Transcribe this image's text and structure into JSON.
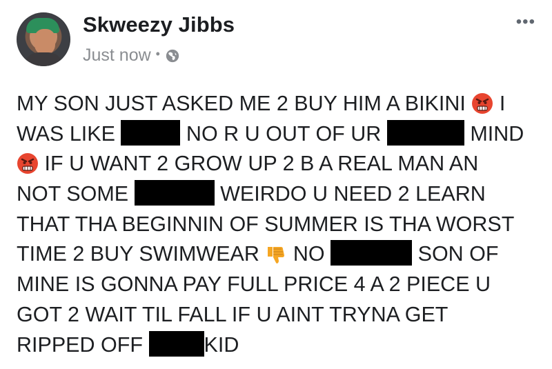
{
  "post": {
    "author": "Skweezy Jibbs",
    "timestamp": "Just now",
    "privacy_icon": "globe-icon",
    "more_label": "•••",
    "lines": [
      [
        "MY SON JUST ASKED ME 2 BUY HIM A BIKINI",
        "I"
      ],
      [
        "WAS LIKE",
        "NO R U OUT OF UR",
        "MIND"
      ],
      [
        "IF U WANT 2 GROW UP 2 B A REAL MAN AN"
      ],
      [
        "NOT SOME",
        "WEIRDO U NEED 2 LEARN"
      ],
      [
        "THAT THA BEGINNIN OF SUMMER IS THA WORST"
      ],
      [
        "TIME 2 BUY SWIMWEAR",
        "NO",
        "SON OF"
      ],
      [
        "MINE IS GONNA PAY FULL PRICE 4 A 2 PIECE U"
      ],
      [
        "GOT 2 WAIT TIL FALL IF U AINT TRYNA GET"
      ],
      [
        "RIPPED OFF",
        "KID"
      ]
    ],
    "emojis": [
      "angry-face-icon",
      "angry-face-icon",
      "thumbs-down-icon"
    ],
    "colors": {
      "text": "#1c1e21",
      "meta": "#8a8d91",
      "redaction": "#000000",
      "emoji_angry": "#e8452f",
      "emoji_thumb": "#f5a623"
    }
  }
}
